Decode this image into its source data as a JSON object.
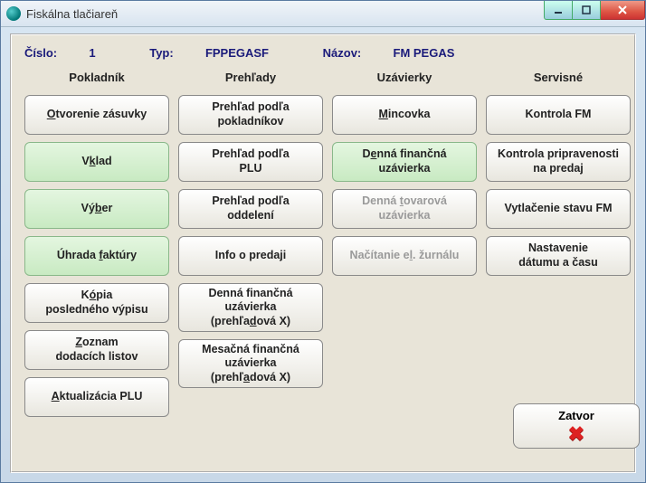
{
  "window": {
    "title": "Fiskálna tlačiareň"
  },
  "info": {
    "cislo_label": "Číslo:",
    "cislo_value": "1",
    "typ_label": "Typ:",
    "typ_value": "FPPEGASF",
    "nazov_label": "Názov:",
    "nazov_value": "FM PEGAS"
  },
  "columns": {
    "pokladnik": "Pokladník",
    "prehlady": "Prehľady",
    "uzavierky": "Uzávierky",
    "servisne": "Servisné"
  },
  "buttons": {
    "otvorenie_zasuvky": "Otvorenie zásuvky",
    "vklad": "Vklad",
    "vyber": "Výber",
    "uhrada_faktury": "Úhrada faktúry",
    "kopia": "Kópia posledného výpisu",
    "zoznam": "Zoznam dodacích listov",
    "aktualizacia": "Aktualizácia PLU",
    "prehlad_pokladnikov": "Prehľad podľa pokladníkov",
    "prehlad_plu": "Prehľad podľa PLU",
    "prehlad_oddeleni": "Prehľad podľa oddelení",
    "info_predaj": "Info o predaji",
    "denna_fin_x": "Denná finančná uzávierka (prehľadová X)",
    "mesacna_fin_x": "Mesačná finančná uzávierka (prehľadová X)",
    "mincovka": "Mincovka",
    "denna_fin": "Denná finančná uzávierka",
    "denna_tov": "Denná tovarová uzávierka",
    "nacitanie": "Načítanie el. žurnálu",
    "kontrola_fm": "Kontrola FM",
    "kontrola_prip": "Kontrola pripravenosti na predaj",
    "vytlacenie": "Vytlačenie stavu FM",
    "nastavenie": "Nastavenie dátumu a času",
    "zatvor": "Zatvor"
  }
}
